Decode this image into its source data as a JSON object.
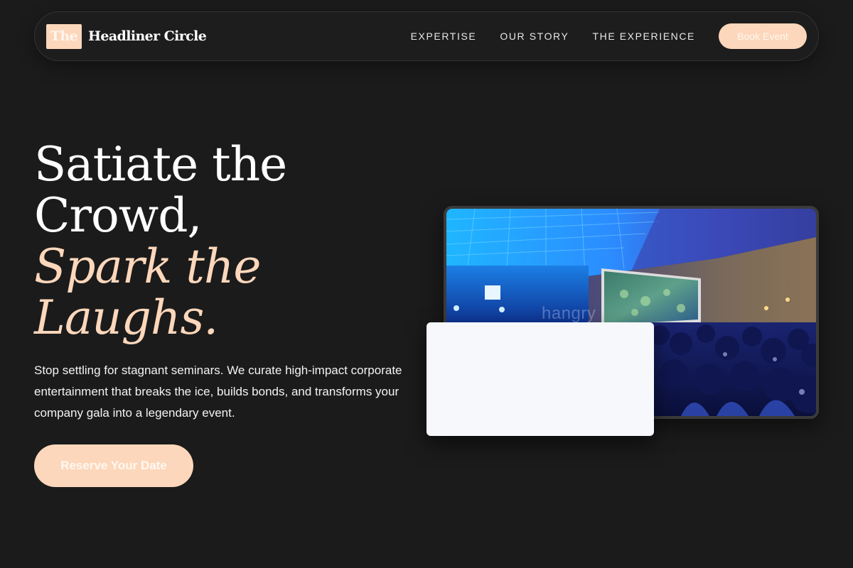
{
  "brand": {
    "badge": "The",
    "name": "Headliner Circle"
  },
  "nav": {
    "links": [
      "EXPERTISE",
      "OUR STORY",
      "THE EXPERIENCE"
    ],
    "cta": "Book Event"
  },
  "hero": {
    "title_line_1": "Satiate the",
    "title_line_2": "Crowd,",
    "title_accent_1": "Spark the",
    "title_accent_2": "Laughs.",
    "description": "Stop settling for stagnant seminars. We curate high-impact corporate entertainment that breaks the ice, builds bonds, and transforms your company gala into a legendary event.",
    "cta": "Reserve Your Date"
  },
  "photo": {
    "icon": "conference-audience-photo",
    "watermark": "hangry"
  },
  "colors": {
    "background": "#1b1b1b",
    "accent": "#fdd7bb",
    "text": "#ffffff",
    "card": "#f6f8fb"
  }
}
